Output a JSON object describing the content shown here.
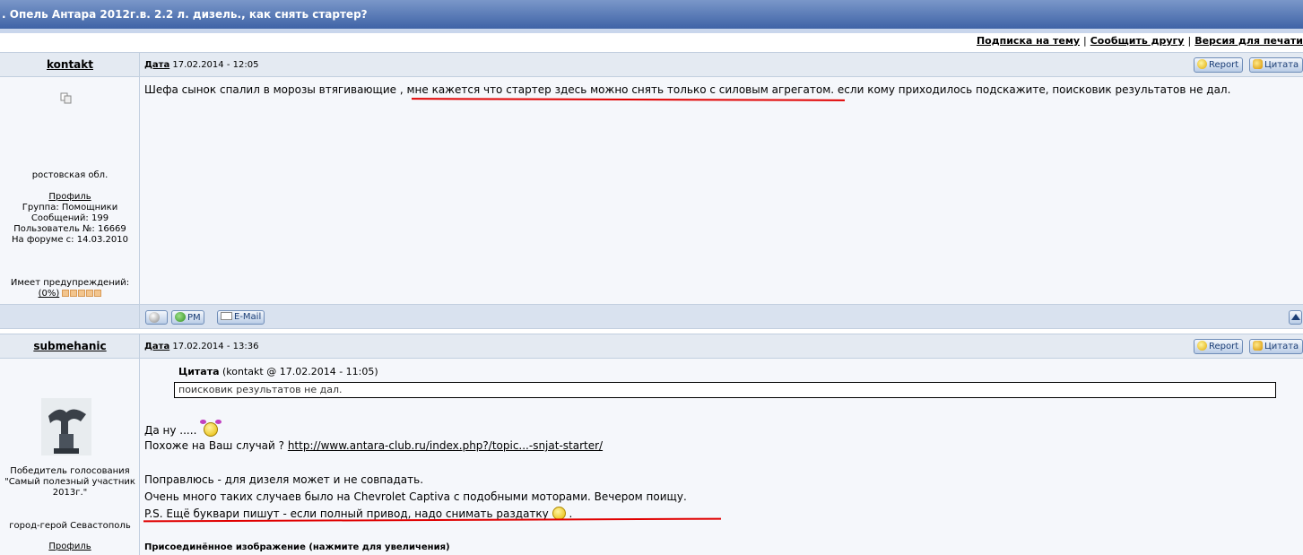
{
  "topic_title": ". Опель Антара 2012г.в. 2.2 л. дизель., как снять стартер?",
  "top_links": {
    "subscribe": "Подписка на тему",
    "tell_friend": "Сообщить другу",
    "print_version": "Версия для печати",
    "sep": "|"
  },
  "labels": {
    "date": "Дата",
    "report": "Report",
    "quote": "Цитата",
    "pm": "PM",
    "email": "E-Mail",
    "profile": "Профиль",
    "quote_header": "Цитата",
    "attached_image": "Присоединённое изображение (нажмите для увеличения)"
  },
  "posts": [
    {
      "author": "kontakt",
      "date": "17.02.2014 - 12:05",
      "location": "ростовская обл.",
      "group": "Группа: Помощники",
      "messages": "Сообщений: 199",
      "user_no": "Пользователь №: 16669",
      "joined": "На форуме с: 14.03.2010",
      "warnings_label": "Имеет предупреждений:",
      "warnings_value": "(0%)",
      "text_part1": "Шефа сынок спалил в морозы втягивающие , ",
      "text_part2": "мне кажется что стартер здесь можно снять только с силовым агрегатом",
      "text_part3": ". если кому приходилось подскажите, поисковик результатов не дал."
    },
    {
      "author": "submehanic",
      "date": "17.02.2014 - 13:36",
      "award": "Победитель голосования \"Самый полезный участник 2013г.\"",
      "location": "город-герой Севастополь",
      "quote_meta": "(kontakt @ 17.02.2014 - 11:05)",
      "quote_text": "поисковик результатов не дал.",
      "line1": "Да ну .....",
      "line2_text": "Похоже на Ваш случай ? ",
      "line2_link": "http://www.antara-club.ru/index.php?/topic...-snjat-starter/",
      "line3": "Поправлюсь - для дизеля может и не совпадать.",
      "line4": "Очень много таких случаев было на Chevrolet Captiva с подобными моторами. Вечером поищу.",
      "line5": "P.S. Ещё буквари пишут - если полный привод, надо снимать раздатку",
      "line5_end": "."
    }
  ],
  "colors": {
    "title_bar": "#3f63a6",
    "header_row": "#e4eaf2",
    "underline_marker": "#e00000"
  }
}
